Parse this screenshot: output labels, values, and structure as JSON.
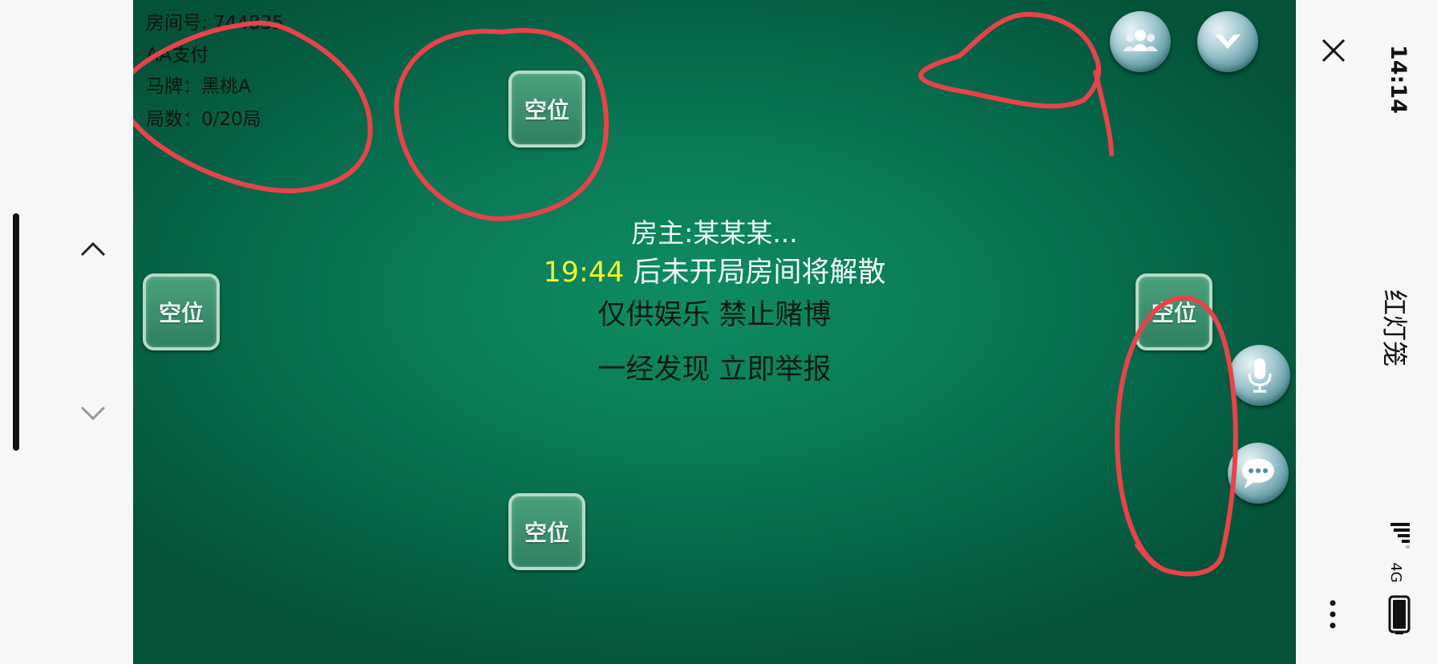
{
  "room": {
    "room_number": "房间号: 744835",
    "payment": "AA支付",
    "horse_card": "马牌：黑桃A",
    "rounds": "局数：0/20局"
  },
  "seats": {
    "empty_label": "空位"
  },
  "center": {
    "host": "房主:某某某...",
    "countdown": "19:44",
    "countdown_suffix": " 后未开局房间将解散",
    "warning_1": "仅供娱乐  禁止赌博",
    "warning_2": "一经发现  立即举报"
  },
  "status": {
    "time": "14:14",
    "app_title": "红灯笼",
    "network": "4G"
  },
  "icons": {
    "close": "close-icon",
    "more": "more-vertical-icon",
    "scroll_up": "chevron-up-icon",
    "scroll_down": "chevron-down-icon",
    "players": "players-icon",
    "dropdown": "dropdown-arrow-icon",
    "mic": "microphone-icon",
    "chat": "chat-bubble-icon",
    "signal": "signal-icon",
    "battery": "battery-icon"
  },
  "colors": {
    "table_green": "#0a7a56",
    "countdown_yellow": "#f5f42a",
    "annotation_red": "#e8434a",
    "seat_border": "#b5dac5"
  }
}
